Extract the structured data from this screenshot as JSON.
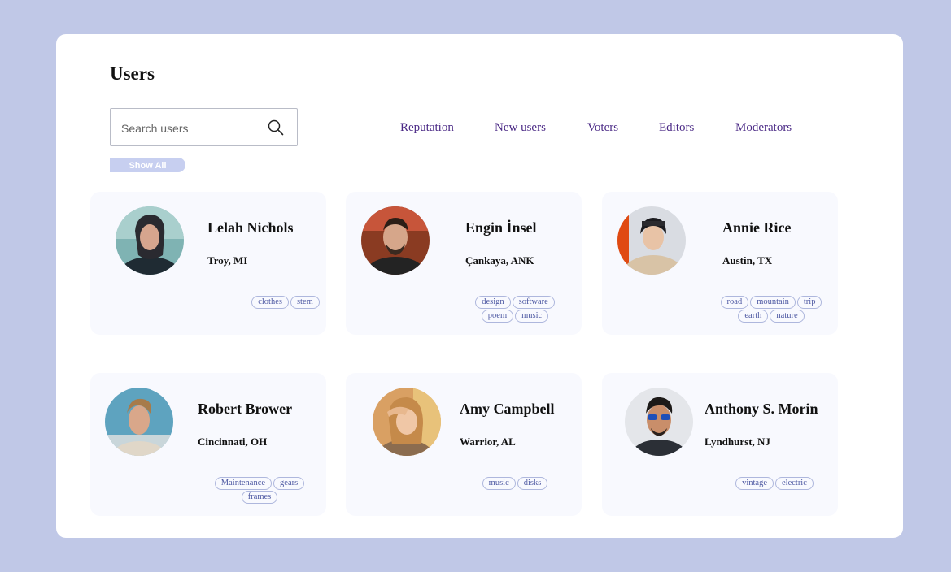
{
  "page": {
    "title": "Users"
  },
  "search": {
    "placeholder": "Search users",
    "icon": "search-icon"
  },
  "show_all_label": "Show All",
  "nav": {
    "tabs": [
      "Reputation",
      "New users",
      "Voters",
      "Editors",
      "Moderators"
    ]
  },
  "colors": {
    "background": "#c0c8e7",
    "panel": "#ffffff",
    "card": "#f8f9fe",
    "nav_text": "#4b2a86",
    "tag_text": "#4f5aa3",
    "show_all_bg": "#c7cff0"
  },
  "users": [
    {
      "name": "Lelah Nichols",
      "location": "Troy, MI",
      "tags": [
        "clothes",
        "stem"
      ]
    },
    {
      "name": "Engin İnsel",
      "location": "Çankaya, ANK",
      "tags": [
        "design",
        "software",
        "poem",
        "music"
      ]
    },
    {
      "name": "Annie Rice",
      "location": "Austin, TX",
      "tags": [
        "road",
        "mountain",
        "trip",
        "earth",
        "nature"
      ]
    },
    {
      "name": "Robert Brower",
      "location": "Cincinnati, OH",
      "tags": [
        "Maintenance",
        "gears",
        "frames"
      ]
    },
    {
      "name": "Amy Campbell",
      "location": "Warrior, AL",
      "tags": [
        "music",
        "disks"
      ]
    },
    {
      "name": "Anthony S. Morin",
      "location": "Lyndhurst, NJ",
      "tags": [
        "vintage",
        "electric"
      ]
    }
  ]
}
